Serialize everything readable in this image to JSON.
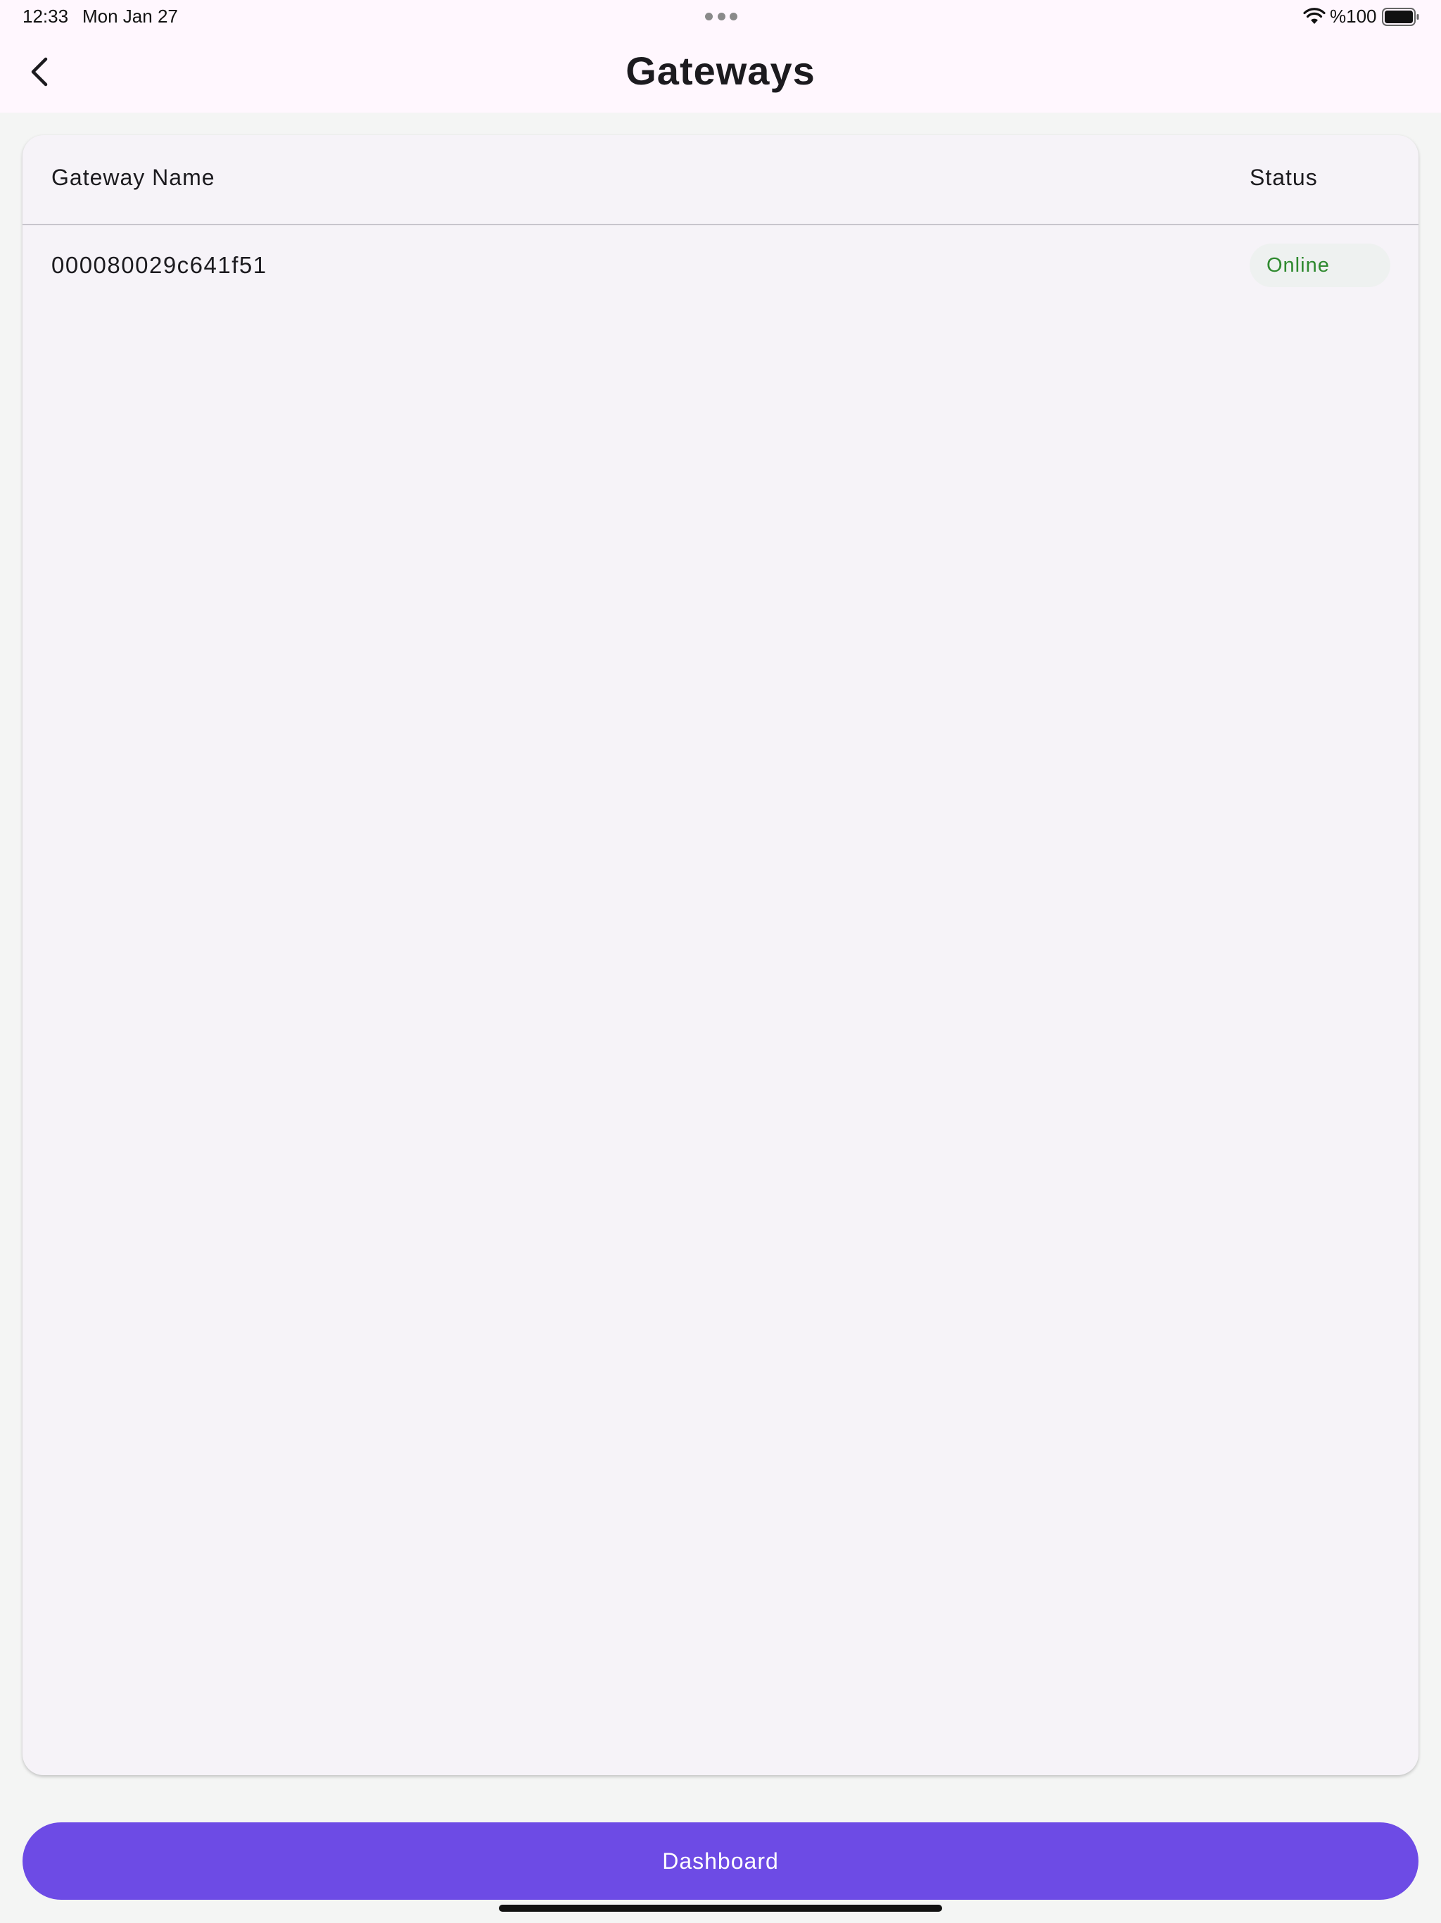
{
  "status_bar": {
    "time": "12:33",
    "date": "Mon Jan 27",
    "battery": "%100"
  },
  "header": {
    "title": "Gateways",
    "back_icon": "chevron-left-icon"
  },
  "table": {
    "columns": [
      "Gateway Name",
      "Status"
    ],
    "rows": [
      {
        "name": "000080029c641f51",
        "status": "Online"
      }
    ]
  },
  "footer": {
    "dashboard_label": "Dashboard"
  },
  "colors": {
    "accent": "#6d4be5",
    "online": "#2f8a2f",
    "header_background": "#fff7fe",
    "card_background": "#f6f3f8"
  }
}
